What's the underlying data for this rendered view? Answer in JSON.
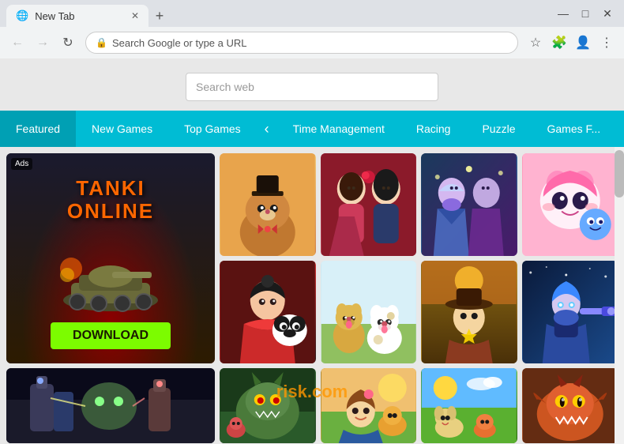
{
  "browser": {
    "tab_title": "New Tab",
    "omnibar_placeholder": "Search Google or type a URL",
    "window_controls": {
      "minimize": "—",
      "maximize": "□",
      "close": "✕"
    }
  },
  "search": {
    "placeholder": "Search web"
  },
  "categories": [
    {
      "label": "Featured",
      "active": true
    },
    {
      "label": "New Games",
      "active": false
    },
    {
      "label": "Top Games",
      "active": false
    },
    {
      "label": "Time Management",
      "active": false
    },
    {
      "label": "Racing",
      "active": false
    },
    {
      "label": "Puzzle",
      "active": false
    },
    {
      "label": "Games F...",
      "active": false
    }
  ],
  "featured_game": {
    "ads_label": "Ads",
    "title_line1": "TANKI",
    "title_line2": "ONLINE",
    "download_label": "DOWNLOAD"
  },
  "game_thumbs": [
    {
      "id": "orange-cat",
      "style": "gt-orange-cat"
    },
    {
      "id": "romance",
      "style": "gt-romance"
    },
    {
      "id": "fantasy",
      "style": "gt-fantasy"
    },
    {
      "id": "kawaii",
      "style": "gt-kawaii"
    },
    {
      "id": "panda",
      "style": "gt-panda"
    },
    {
      "id": "dogs",
      "style": "gt-dogs"
    },
    {
      "id": "western",
      "style": "gt-western"
    },
    {
      "id": "scifi",
      "style": "gt-scifi"
    }
  ],
  "bottom_thumbs": [
    {
      "id": "shooter",
      "style": "bt-dark-shooter"
    },
    {
      "id": "monsters",
      "style": "bt-monsters"
    },
    {
      "id": "adventure",
      "style": "bt-adventure"
    },
    {
      "id": "farm",
      "style": "bt-farm"
    },
    {
      "id": "creature",
      "style": "bt-creature"
    }
  ],
  "watermark": "risk.com"
}
